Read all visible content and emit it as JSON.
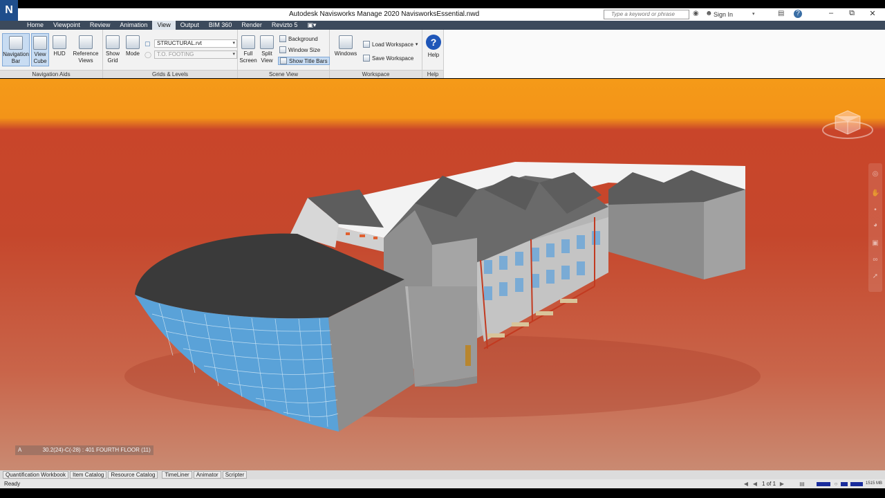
{
  "titlebar": {
    "logo": "N",
    "title": "Autodesk Navisworks Manage 2020    NavisworksEssential.nwd",
    "search_placeholder": "Type a keyword or phrase",
    "signin": "Sign In",
    "minimize": "–",
    "restore": "⧉",
    "close": "✕"
  },
  "tabs": [
    {
      "label": "Home"
    },
    {
      "label": "Viewpoint"
    },
    {
      "label": "Review"
    },
    {
      "label": "Animation"
    },
    {
      "label": "View",
      "active": true
    },
    {
      "label": "Output"
    },
    {
      "label": "BIM 360"
    },
    {
      "label": "Render"
    },
    {
      "label": "Revizto 5"
    }
  ],
  "ribbon": {
    "navigation_aids": {
      "title": "Navigation Aids",
      "navigation_bar": "Navigation Bar",
      "view_cube": "View Cube",
      "hud": "HUD",
      "reference_views": "Reference Views"
    },
    "grids_levels": {
      "title": "Grids & Levels",
      "show_grid": "Show Grid",
      "mode": "Mode",
      "model_combo": "STRUCTURAL.rvt",
      "level_combo": "T.O. FOOTING"
    },
    "scene_view": {
      "title": "Scene View",
      "full_screen": "Full Screen",
      "split_view": "Split View",
      "background": "Background",
      "window_size": "Window Size",
      "show_title_bars": "Show Title Bars"
    },
    "workspace": {
      "title": "Workspace",
      "windows": "Windows",
      "load_workspace": "Load Workspace",
      "save_workspace": "Save Workspace"
    },
    "help": {
      "title": "Help",
      "help": "Help"
    }
  },
  "viewport": {
    "grid_axis": "A",
    "grid_location": "30.2(24)-C(-28) : 401 FOURTH FLOOR (11)"
  },
  "bottom_tabs": [
    {
      "label": "Quantification Workbook"
    },
    {
      "label": "Item Catalog"
    },
    {
      "label": "Resource Catalog"
    },
    {
      "label": "TimeLiner",
      "gap": true
    },
    {
      "label": "Animator"
    },
    {
      "label": "Scripter"
    }
  ],
  "statusbar": {
    "status": "Ready",
    "page": "1 of 1",
    "memory": "1515 MB"
  },
  "colors": {
    "sky": "#f59a18",
    "ground": "#c5472c",
    "tabbar": "#3c4a5c",
    "glass": "#5aa2d8"
  }
}
